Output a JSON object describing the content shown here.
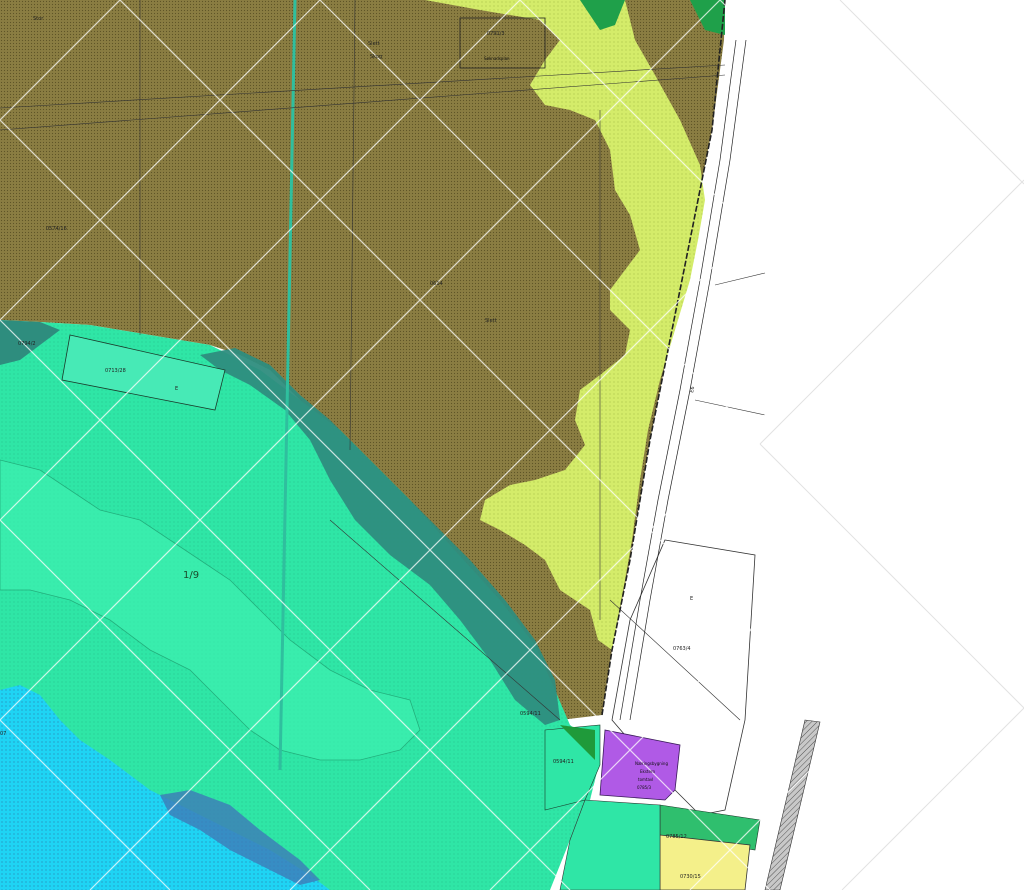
{
  "map": {
    "colors": {
      "farmland": "#8a7d42",
      "light_green": "#d4ec6a",
      "forest_green": "#2fe6a6",
      "dark_teal": "#2e8d7e",
      "water": "#1fd4f4",
      "purple_building": "#b05ae6",
      "yellow_plot": "#f4f08a",
      "white_area": "#ffffff",
      "road_gray": "#9a9a9a"
    },
    "labels": {
      "north_plot": "0791/3",
      "north_plot_sub": "Søknadsplan",
      "top_left_a": "Stor",
      "top_mid_a": "Slett",
      "top_mid_b": "Skog",
      "field_plot": "0574/16",
      "field_center": "0614",
      "field_right": "Slett",
      "left_strip": "0713/28",
      "left_strip_sym": "E",
      "left_small": "0794/2",
      "center_green": "1/9",
      "left_edge": "07",
      "white_plot_sym": "E",
      "white_plot": "0763/4",
      "bottom_plot": "0594/11",
      "bottom_plot_b": "0594/11",
      "purple_text_1": "Næringsbygning",
      "purple_text_2": "Ekstern",
      "purple_text_3": "tomtavl",
      "purple_text_4": "0785/3",
      "yellow_plot_label": "0730/15",
      "mid_small": "0785/12",
      "road_label": "E6"
    }
  }
}
